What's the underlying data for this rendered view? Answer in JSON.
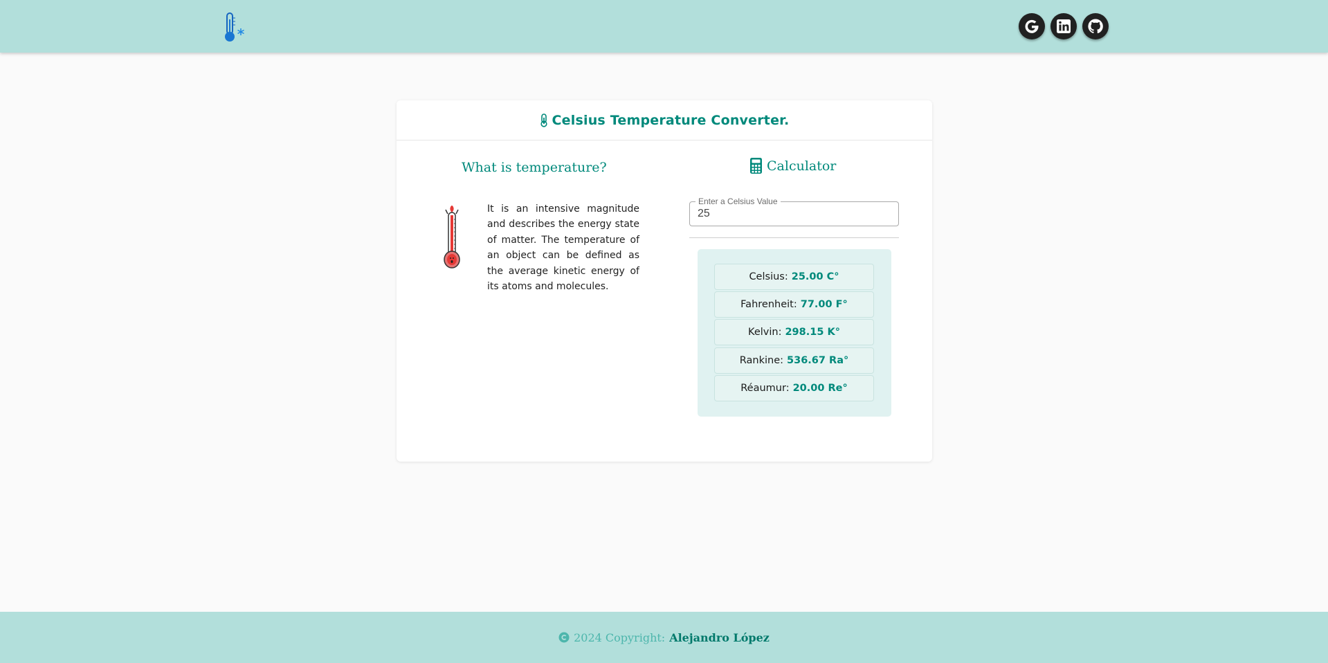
{
  "header": {
    "logo_icon": "thermometer-snowflake-icon",
    "social": [
      {
        "name": "google",
        "icon": "google-icon"
      },
      {
        "name": "linkedin",
        "icon": "linkedin-icon"
      },
      {
        "name": "github",
        "icon": "github-icon"
      }
    ]
  },
  "card": {
    "title": "Celsius Temperature Converter.",
    "title_icon": "thermometer-icon"
  },
  "info": {
    "heading": "What is temperature?",
    "image_icon": "hot-thermometer-icon",
    "description": "It is an intensive magnitude and describes the energy state of matter. The temperature of an object can be defined as the average kinetic energy of its atoms and molecules."
  },
  "calculator": {
    "heading": "Calculator",
    "heading_icon": "calculator-icon",
    "input_label": "Enter a Celsius Value",
    "input_value": "25",
    "results": [
      {
        "label": "Celsius:",
        "value": "25.00 C°"
      },
      {
        "label": "Fahrenheit:",
        "value": "77.00 F°"
      },
      {
        "label": "Kelvin:",
        "value": "298.15 K°"
      },
      {
        "label": "Rankine:",
        "value": "536.67 Ra°"
      },
      {
        "label": "Réaumur:",
        "value": "20.00 Re°"
      }
    ]
  },
  "footer": {
    "copyright_icon": "copyright-icon",
    "copyright_text": "2024 Copyright:",
    "author": "Alejandro López"
  },
  "colors": {
    "header_bg": "#b2dfdb",
    "accent": "#00897b",
    "results_bg": "#e0f2f1",
    "page_bg": "#fafafa"
  }
}
